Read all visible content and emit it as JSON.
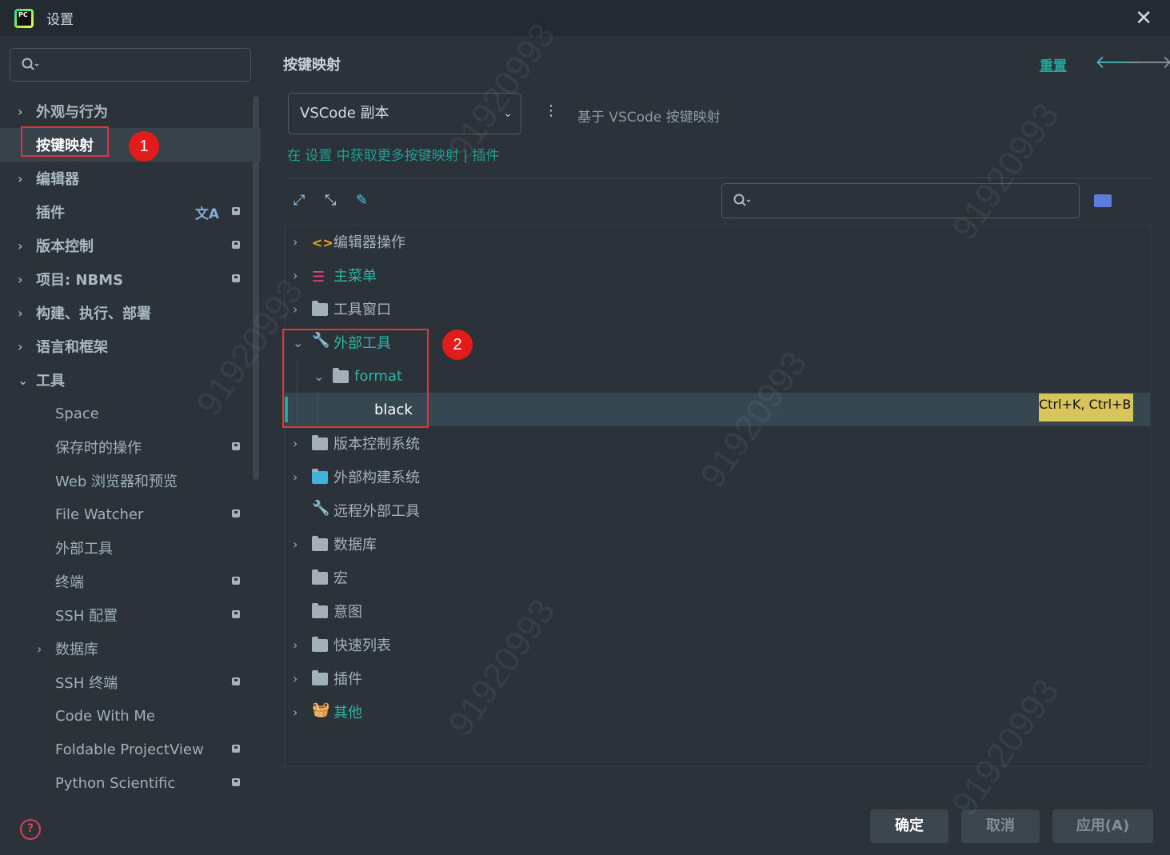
{
  "window": {
    "title": "设置",
    "close_symbol": "✕"
  },
  "sidebar": {
    "items": [
      {
        "label": "外观与行为"
      },
      {
        "label": "按键映射"
      },
      {
        "label": "编辑器"
      },
      {
        "label": "插件"
      },
      {
        "label": "版本控制"
      },
      {
        "label": "项目: NBMS"
      },
      {
        "label": "构建、执行、部署"
      },
      {
        "label": "语言和框架"
      },
      {
        "label": "工具"
      },
      {
        "label": "Space"
      },
      {
        "label": "保存时的操作"
      },
      {
        "label": "Web 浏览器和预览"
      },
      {
        "label": "File Watcher"
      },
      {
        "label": "外部工具"
      },
      {
        "label": "终端"
      },
      {
        "label": "SSH 配置"
      },
      {
        "label": "数据库"
      },
      {
        "label": "SSH 终端"
      },
      {
        "label": "Code With Me"
      },
      {
        "label": "Foldable ProjectView"
      },
      {
        "label": "Python Scientific"
      }
    ]
  },
  "annotations": {
    "one": "1",
    "two": "2"
  },
  "main": {
    "title": "按键映射",
    "reset_label": "重置",
    "keymap_value": "VSCode 副本",
    "based_on": "基于 VSCode 按键映射",
    "more_link": "在 设置 中获取更多按键映射 | 插件",
    "tree": [
      {
        "label": "编辑器操作"
      },
      {
        "label": "主菜单"
      },
      {
        "label": "工具窗口"
      },
      {
        "label": "外部工具"
      },
      {
        "label": "format"
      },
      {
        "label": "black",
        "shortcut": "Ctrl+K, Ctrl+B"
      },
      {
        "label": "版本控制系统"
      },
      {
        "label": "外部构建系统"
      },
      {
        "label": "远程外部工具"
      },
      {
        "label": "数据库"
      },
      {
        "label": "宏"
      },
      {
        "label": "意图"
      },
      {
        "label": "快速列表"
      },
      {
        "label": "插件"
      },
      {
        "label": "其他"
      }
    ]
  },
  "footer": {
    "ok_label": "确定",
    "cancel_label": "取消",
    "apply_label": "应用(A)",
    "help_symbol": "?"
  },
  "watermark": "91920993",
  "colors": {
    "accent": "#20a89a",
    "highlight_box": "#e13636",
    "shortcut_bg": "#d7c55b"
  }
}
